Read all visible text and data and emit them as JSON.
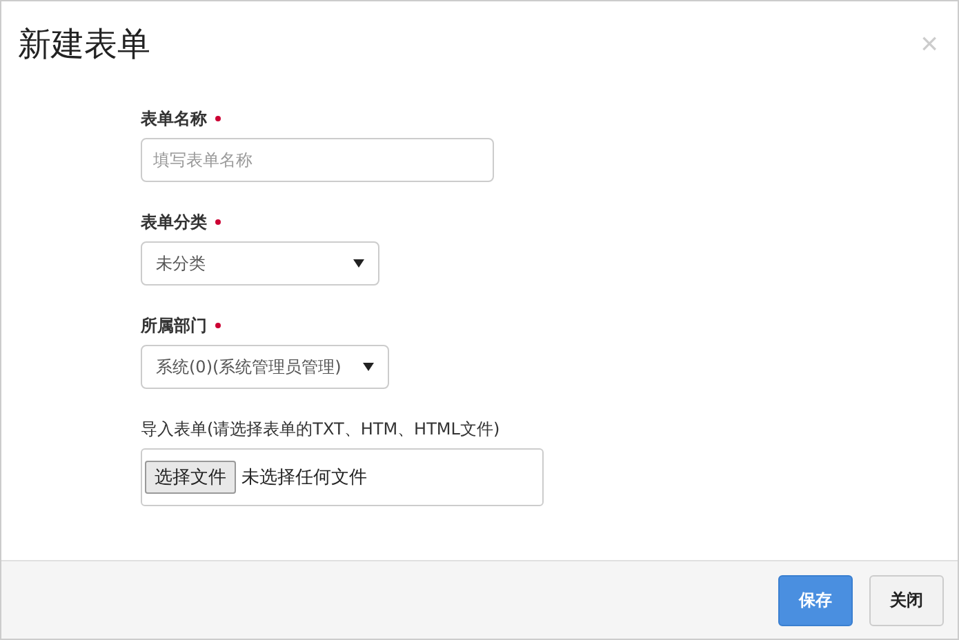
{
  "dialog": {
    "title": "新建表单",
    "close": "×"
  },
  "fields": [
    {
      "kind": "text",
      "label": "表单名称",
      "required": true,
      "placeholder": "填写表单名称"
    },
    {
      "kind": "select",
      "label": "表单分类",
      "required": true,
      "value": "未分类"
    },
    {
      "kind": "select",
      "label": "所属部门",
      "required": true,
      "value": "系统(0)(系统管理员管理)"
    },
    {
      "kind": "file",
      "label": "导入表单(请选择表单的TXT、HTM、HTML文件)",
      "button": "选择文件",
      "value": "未选择任何文件"
    }
  ],
  "buttons": [
    {
      "label": "保存",
      "kind": "primary"
    },
    {
      "label": "关闭",
      "kind": "default"
    }
  ]
}
